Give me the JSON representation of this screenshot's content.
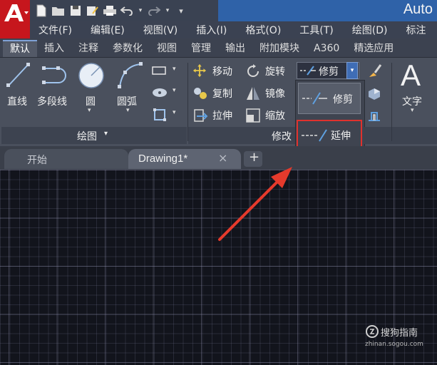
{
  "window": {
    "title": "Auto"
  },
  "menu": [
    "文件(F)",
    "编辑(E)",
    "视图(V)",
    "插入(I)",
    "格式(O)",
    "工具(T)",
    "绘图(D)",
    "标注"
  ],
  "ribbon_tabs": [
    "默认",
    "插入",
    "注释",
    "参数化",
    "视图",
    "管理",
    "输出",
    "附加模块",
    "A360",
    "精选应用"
  ],
  "draw_panel": {
    "line": "直线",
    "polyline": "多段线",
    "circle": "圆",
    "arc": "圆弧",
    "footer": "绘图"
  },
  "modify_panel": {
    "move": "移动",
    "rotate": "旋转",
    "copy": "复制",
    "mirror": "镜像",
    "stretch": "拉伸",
    "scale": "缩放",
    "footer": "修改",
    "trim_combo": "修剪",
    "dropdown_trim": "修剪",
    "dropdown_extend": "延伸"
  },
  "annotation_panel": {
    "text": "文字",
    "text_glyph": "A"
  },
  "doc_tabs": {
    "start": "开始",
    "drawing": "Drawing1*",
    "close": "×",
    "add": "+"
  },
  "watermark": {
    "brand": "搜狗指南",
    "url": "zhinan.sogou.com"
  },
  "colors": {
    "highlight_box": "#e0312d",
    "arrow": "#e53a2c",
    "logo": "#c6161d",
    "title_band": "#2f62a8"
  }
}
